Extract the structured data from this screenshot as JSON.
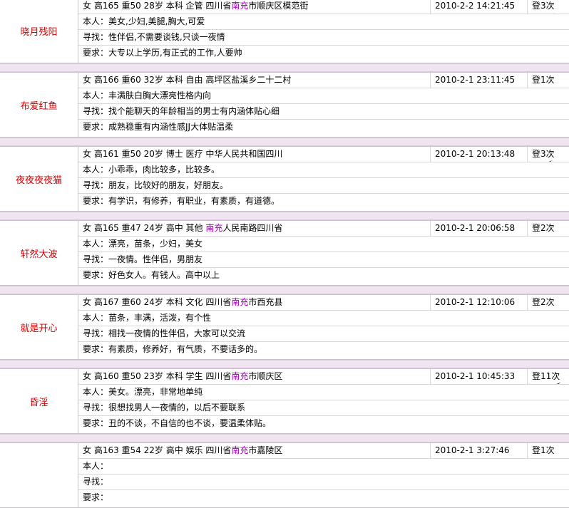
{
  "labels": {
    "self": "本人：",
    "seek": "寻找：",
    "require": "要求："
  },
  "entries": [
    {
      "name": "晓月残阳",
      "basic_pre": "女 高165 重50 28岁 本科 企管 四川省",
      "basic_hl": "南充",
      "basic_post": "市顺庆区模范街",
      "time": "2010-2-2 14:21:45",
      "logins": "登3次",
      "self": "美女,少妇,美腿,胸大,可爱",
      "seek": "性伴侣,不需要谈钱,只谈一夜情",
      "require": "大专以上学历,有正式的工作,人要帅"
    },
    {
      "name": "布爱红鱼",
      "basic_pre": "女 高166 重60 32岁 本科 自由 高坪区盐溪乡二十二村",
      "basic_hl": "",
      "basic_post": "",
      "time": "2010-2-1 23:11:45",
      "logins": "登1次",
      "self": "丰满肤白胸大漂亮性格内向",
      "seek": "找个能聊天的年龄相当的男士有内涵体贴心细",
      "require": "成熟稳重有内涵性感JJ大体贴温柔"
    },
    {
      "name": "夜夜夜夜猫",
      "basic_pre": "女 高161 重50 20岁 博士 医疗 中华人民共和国四川",
      "basic_hl": "",
      "basic_post": "",
      "time": "2010-2-1 20:13:48",
      "logins": "登3次",
      "self": "小乖乖，肉比较多，比较多。",
      "seek": "朋友，比较好的朋友，好朋友。",
      "require": "有学识，有修养，有职业，有素质，有道德。"
    },
    {
      "name": "轩然大波",
      "basic_pre": "女 高165 重47 24岁 高中 其他 ",
      "basic_hl": "南充",
      "basic_post": "人民南路四川省",
      "time": "2010-2-1 20:06:58",
      "logins": "登2次",
      "self": "漂亮，苗条，少妇，美女",
      "seek": "一夜情。性伴侣，男朋友",
      "require": "好色女人。有钱人。高中以上"
    },
    {
      "name": "就是开心",
      "basic_pre": "女 高167 重60 24岁 本科 文化 四川省",
      "basic_hl": "南充",
      "basic_post": "市西充县",
      "time": "2010-2-1 12:10:06",
      "logins": "登2次",
      "self": "苗条，丰满，活泼，有个性",
      "seek": "相找一夜情的性伴侣，大家可以交流",
      "require": "有素质，修养好，有气质，不要话多的。"
    },
    {
      "name": "昏淫",
      "basic_pre": "女 高160 重50 23岁 本科 学生 四川省",
      "basic_hl": "南充",
      "basic_post": "市顺庆区",
      "time": "2010-2-1 10:45:33",
      "logins": "登11次",
      "self": "美女。漂亮，非常地单纯",
      "seek": "很想找男人一夜情的，以后不要联系",
      "require": "丑的不谈，不自信的也不谈，要温柔体贴。"
    },
    {
      "name": "",
      "basic_pre": "女 高163 重54 22岁 高中 娱乐 四川省",
      "basic_hl": "南充",
      "basic_post": "市嘉陵区",
      "time": "2010-2-1 3:27:46",
      "logins": "登1次",
      "self": "",
      "seek": "",
      "require": ""
    }
  ]
}
